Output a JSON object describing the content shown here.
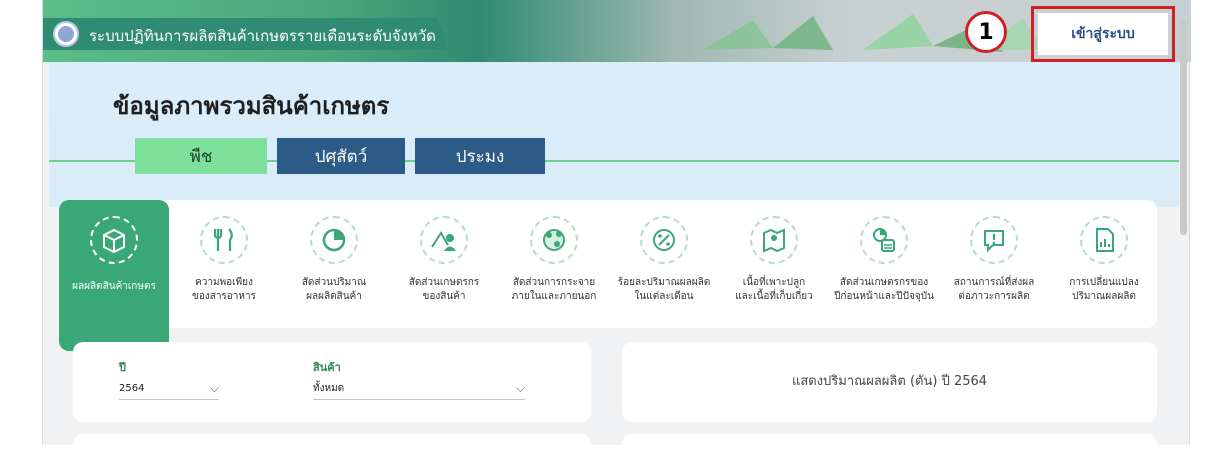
{
  "header": {
    "site_title": "ระบบปฏิทินการผลิตสินค้าเกษตรรายเดือนระดับจังหวัด",
    "login_label": "เข้าสู่ระบบ",
    "callout_number": "1"
  },
  "hero": {
    "title": "ข้อมูลภาพรวมสินค้าเกษตร",
    "tabs": [
      "พืช",
      "ปศุสัตว์",
      "ประมง"
    ]
  },
  "menu": {
    "items": [
      {
        "label": "ผลผลิตสินค้าเกษตร",
        "icon": "box-icon"
      },
      {
        "label": "ความพอเพียง\nของสารอาหาร",
        "icon": "cutlery-icon"
      },
      {
        "label": "สัดส่วนปริมาณ\nผลผลิตสินค้า",
        "icon": "pie-chart-icon"
      },
      {
        "label": "สัดส่วนเกษตรกร\nของสินค้า",
        "icon": "farmer-icon"
      },
      {
        "label": "สัดส่วนการกระจาย\nภายในและภายนอก",
        "icon": "globe-icon"
      },
      {
        "label": "ร้อยละปริมาณผลผลิต\nในแต่ละเดือน",
        "icon": "percent-icon"
      },
      {
        "label": "เนื้อที่เพาะปลูก\nและเนื้อที่เก็บเกี่ยว",
        "icon": "map-icon"
      },
      {
        "label": "สัดส่วนเกษตรกรของ\nปีก่อนหน้าและปีปัจจุบัน",
        "icon": "calendar-chart-icon"
      },
      {
        "label": "สถานการณ์ที่ส่งผล\nต่อภาวะการผลิต",
        "icon": "alert-message-icon"
      },
      {
        "label": "การเปลี่ยนแปลง\nปริมาณผลผลิต",
        "icon": "document-chart-icon"
      }
    ]
  },
  "filters": {
    "year_label": "ปี",
    "year_value": "2564",
    "product_label": "สินค้า",
    "product_value": "ทั้งหมด"
  },
  "summary": {
    "text": "แสดงปริมาณผลผลิต (ตัน) ปี 2564"
  },
  "colors": {
    "accent_green": "#3aa777",
    "tab_blue": "#2d5b88",
    "tab_green": "#7ee19b",
    "callout_red": "#d21f26"
  }
}
